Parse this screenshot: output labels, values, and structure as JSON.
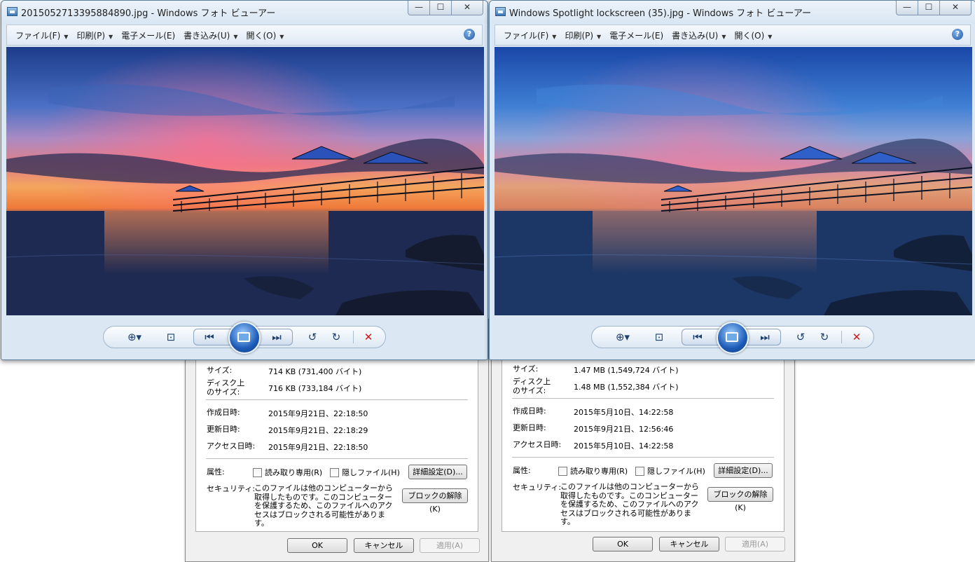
{
  "props": [
    {
      "fields": [
        {
          "label": "サイズ:",
          "value": "714 KB (731,400 バイト)"
        },
        {
          "label": "ディスク上\nのサイズ:",
          "value": "716 KB (733,184 バイト)"
        }
      ],
      "dates": [
        {
          "label": "作成日時:",
          "value": "2015年9月21日、22:18:50"
        },
        {
          "label": "更新日時:",
          "value": "2015年9月21日、22:18:29"
        },
        {
          "label": "アクセス日時:",
          "value": "2015年9月21日、22:18:50"
        }
      ],
      "attributes_label": "属性:",
      "readonly_label": "読み取り専用(R)",
      "hidden_label": "隠しファイル(H)",
      "advanced_button": "詳細設定(D)...",
      "security_label": "セキュリティ:",
      "security_text": "このファイルは他のコンピューターから取得したものです。このコンピューターを保護するため、このファイルへのアクセスはブロックされる可能性があります。",
      "unblock_button": "ブロックの解除(K)",
      "ok_button": "OK",
      "cancel_button": "キャンセル",
      "apply_button": "適用(A)"
    },
    {
      "fields": [
        {
          "label": "サイズ:",
          "value": "1.47 MB (1,549,724 バイト)"
        },
        {
          "label": "ディスク上\nのサイズ:",
          "value": "1.48 MB (1,552,384 バイト)"
        }
      ],
      "dates": [
        {
          "label": "作成日時:",
          "value": "2015年5月10日、14:22:58"
        },
        {
          "label": "更新日時:",
          "value": "2015年9月21日、12:56:46"
        },
        {
          "label": "アクセス日時:",
          "value": "2015年5月10日、14:22:58"
        }
      ],
      "attributes_label": "属性:",
      "readonly_label": "読み取り専用(R)",
      "hidden_label": "隠しファイル(H)",
      "advanced_button": "詳細設定(D)...",
      "security_label": "セキュリティ:",
      "security_text": "このファイルは他のコンピューターから取得したものです。このコンピューターを保護するため、このファイルへのアクセスはブロックされる可能性があります。",
      "unblock_button": "ブロックの解除(K)",
      "ok_button": "OK",
      "cancel_button": "キャンセル",
      "apply_button": "適用(A)"
    }
  ],
  "viewers": [
    {
      "title": "2015052713395884890.jpg - Windows フォト ビューアー",
      "menu": {
        "file": "ファイル(F)",
        "print": "印刷(P)",
        "email": "電子メール(E)",
        "burn": "書き込み(U)",
        "open": "開く(O)"
      },
      "help": "?",
      "tone": "warm"
    },
    {
      "title": "Windows Spotlight lockscreen (35).jpg - Windows フォト ビューアー",
      "menu": {
        "file": "ファイル(F)",
        "print": "印刷(P)",
        "email": "電子メール(E)",
        "burn": "書き込み(U)",
        "open": "開く(O)"
      },
      "help": "?",
      "tone": "cool"
    }
  ],
  "window_buttons": {
    "minimize": "—",
    "maximize": "☐",
    "close": "✕"
  },
  "toolbar_icons": {
    "zoom": "⊕▾",
    "fit": "⊡",
    "prev": "⏮",
    "next": "⏭",
    "rotate_ccw": "↺",
    "rotate_cw": "↻",
    "delete": "✕"
  },
  "colors": {
    "accent": "#1d5bb8",
    "delete": "#d21818",
    "window_frame": "#dbe8f4"
  }
}
